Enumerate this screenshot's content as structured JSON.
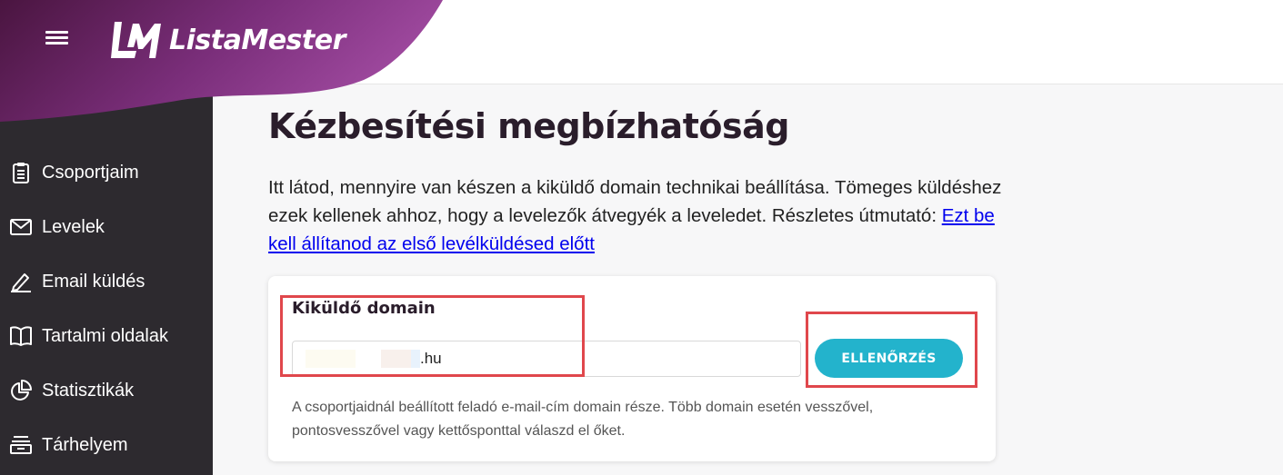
{
  "app": {
    "brand": "ListaMester"
  },
  "sidebar": {
    "items": [
      {
        "label": "Csoportjaim",
        "icon": "clipboard-icon"
      },
      {
        "label": "Levelek",
        "icon": "envelope-icon"
      },
      {
        "label": "Email küldés",
        "icon": "pencil-icon"
      },
      {
        "label": "Tartalmi oldalak",
        "icon": "book-icon"
      },
      {
        "label": "Statisztikák",
        "icon": "pie-chart-icon"
      },
      {
        "label": "Tárhelyem",
        "icon": "storage-icon"
      }
    ]
  },
  "page": {
    "title": "Kézbesítési megbízhatóság",
    "intro_text": "Itt látod, mennyire van készen a kiküldő domain technikai beállítása. Tömeges küldéshez ezek kellenek ahhoz, hogy a levelezők átvegyék a leveledet. Részletes útmutató: ",
    "intro_link": "Ezt be kell állítanod az első levélküldésed előtt"
  },
  "domain_card": {
    "label": "Kiküldő domain",
    "input_value": ".hu",
    "button_label": "ELLENŐRZÉS",
    "hint": "A csoportjaidnál beállított feladó e-mail-cím domain része. Több domain esetén vesszővel, pontosvesszővel vagy kettősponttal válaszd el őket."
  },
  "colors": {
    "sidebar_bg": "#2d2a2f",
    "brand_purple": "#7a2e7a",
    "accent_button": "#23b3cc",
    "highlight_box": "#e0474c",
    "link": "#0000ee"
  }
}
